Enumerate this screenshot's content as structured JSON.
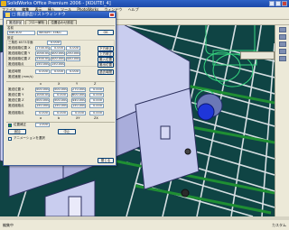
{
  "app": {
    "title": "SolidWorks Office Premium 2006 - [KOUTEI_4]",
    "menu": [
      "ファイル",
      "編集",
      "表示",
      "挿入",
      "ツール",
      "PhotoWorks",
      "ウィンドウ",
      "ヘルプ"
    ]
  },
  "dialog": {
    "title": "□ 搬送部品リストウィンドウ",
    "tabs": [
      "搬送部品",
      "フロー解析",
      "位置合わせ設定"
    ],
    "name_label": "名前",
    "name_value": "NW-400",
    "name_value2": "WEIGHT 35KG",
    "ok": "OK",
    "setting_label": "設定",
    "h1": "三角形 6573平面",
    "h2": "0.000",
    "rows_a": [
      {
        "label": "搬送経路位置 X",
        "v1": "1700.000",
        "v2": "0.000",
        "v3": "0.000",
        "btn": "下方修正"
      },
      {
        "label": "搬送経路位置 Y",
        "v1": "1000.000",
        "v2": "400.000",
        "v3": "250.000",
        "btn": "上方修正"
      },
      {
        "label": "搬送経路位置 Z",
        "v1": "3300.000",
        "v2": "400.000",
        "v3": "440.000",
        "btn": "搬入位置"
      },
      {
        "label": "搬送経路点",
        "v1": "150.000",
        "v2": "150.000",
        "v3": "",
        "btn": "搬出位置"
      }
    ],
    "row_b_label": "搬送時間",
    "row_b": [
      "0.000",
      "0.000",
      "0.000"
    ],
    "row_b_btn": "過去時間",
    "row_b2_label": "搬送速度 (mm/s)",
    "cols": [
      "x",
      "X",
      "Y",
      "Z"
    ],
    "rows_c": [
      {
        "label": "搬送位置 X",
        "v": [
          "500.000",
          "500.000",
          "270.000",
          "0.000"
        ]
      },
      {
        "label": "搬送位置 Y",
        "v": [
          "1000.000",
          "0.000",
          "600.000",
          "0.000"
        ]
      },
      {
        "label": "搬送位置 Z",
        "v": [
          "500.000",
          "500.000",
          "440.000",
          "0.000"
        ]
      },
      {
        "label": "搬送経路点",
        "v": [
          "150.000",
          "150.000",
          "150.000",
          "0.000"
        ]
      }
    ],
    "row_d_label": "搬送経路点",
    "row_d": [
      "0.000",
      "0.000",
      "0.000",
      "0.000"
    ],
    "cols2": [
      "a",
      "b",
      "XY",
      "ZX"
    ],
    "check1": "位置補正",
    "check1_val": "1.000",
    "check1_btn1": "追加",
    "check1_btn2": "中止",
    "check2": "アニメーションを選択",
    "close": "閉じる"
  },
  "statusbar": {
    "left": "編集中",
    "right": "カスタム"
  },
  "colors": {
    "bg": "#0d3a3a",
    "grid": "#dfe6e8",
    "panel": "#c8ccec",
    "accent": "#1d4fae"
  }
}
